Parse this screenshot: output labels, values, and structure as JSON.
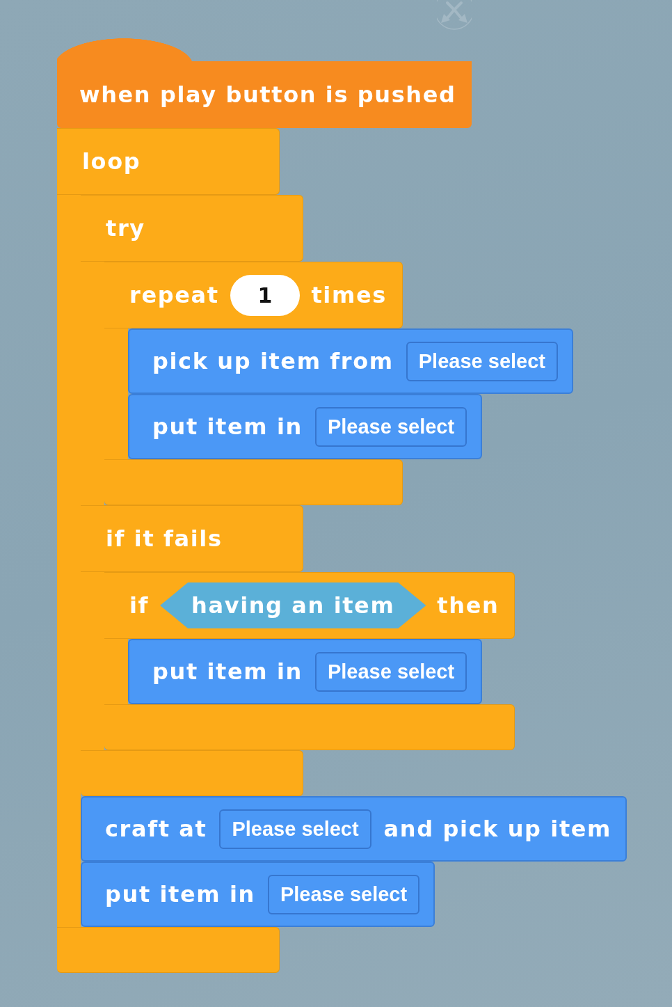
{
  "hat": {
    "text": "when play button is pushed"
  },
  "blocks": [
    {
      "kind": "c",
      "sections": [
        {
          "parts": [
            {
              "kind": "text",
              "text": "loop"
            }
          ],
          "body": [
            {
              "kind": "c",
              "sections": [
                {
                  "parts": [
                    {
                      "kind": "text",
                      "text": "try"
                    }
                  ],
                  "body": [
                    {
                      "kind": "c",
                      "sections": [
                        {
                          "parts": [
                            {
                              "kind": "text",
                              "text": "repeat"
                            },
                            {
                              "kind": "number",
                              "text": "1"
                            },
                            {
                              "kind": "text",
                              "text": "times"
                            }
                          ],
                          "body": [
                            {
                              "kind": "stack",
                              "parts": [
                                {
                                  "kind": "text",
                                  "text": "pick up item from"
                                },
                                {
                                  "kind": "dropdown",
                                  "text": "Please select"
                                }
                              ]
                            },
                            {
                              "kind": "stack",
                              "parts": [
                                {
                                  "kind": "text",
                                  "text": "put item in"
                                },
                                {
                                  "kind": "dropdown",
                                  "text": "Please select"
                                }
                              ]
                            }
                          ]
                        }
                      ]
                    }
                  ]
                },
                {
                  "parts": [
                    {
                      "kind": "text",
                      "text": "if it fails"
                    }
                  ],
                  "body": [
                    {
                      "kind": "c",
                      "sections": [
                        {
                          "parts": [
                            {
                              "kind": "text",
                              "text": "if"
                            },
                            {
                              "kind": "condition",
                              "text": "having an item"
                            },
                            {
                              "kind": "text",
                              "text": "then"
                            }
                          ],
                          "body": [
                            {
                              "kind": "stack",
                              "parts": [
                                {
                                  "kind": "text",
                                  "text": "put item in"
                                },
                                {
                                  "kind": "dropdown",
                                  "text": "Please select"
                                }
                              ]
                            }
                          ]
                        }
                      ]
                    }
                  ]
                }
              ]
            },
            {
              "kind": "stack",
              "parts": [
                {
                  "kind": "text",
                  "text": "craft at"
                },
                {
                  "kind": "dropdown",
                  "text": "Please select"
                },
                {
                  "kind": "text",
                  "text": "and pick up item"
                }
              ]
            },
            {
              "kind": "stack",
              "parts": [
                {
                  "kind": "text",
                  "text": "put item in"
                },
                {
                  "kind": "dropdown",
                  "text": "Please select"
                }
              ]
            }
          ]
        }
      ]
    }
  ]
}
